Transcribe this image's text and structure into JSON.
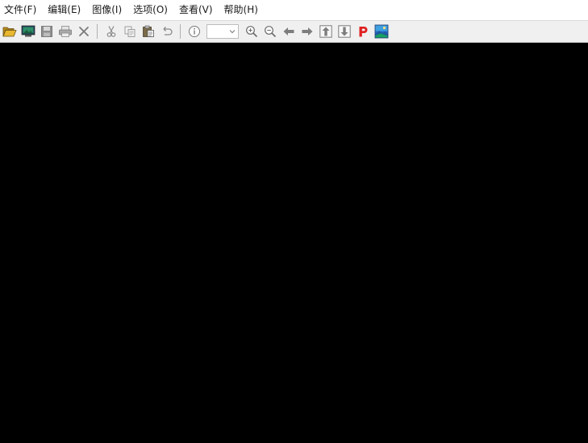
{
  "menu": {
    "items": [
      {
        "id": "file",
        "label": "文件(F)"
      },
      {
        "id": "edit",
        "label": "编辑(E)"
      },
      {
        "id": "image",
        "label": "图像(I)"
      },
      {
        "id": "options",
        "label": "选项(O)"
      },
      {
        "id": "view",
        "label": "查看(V)"
      },
      {
        "id": "help",
        "label": "帮助(H)"
      }
    ]
  },
  "toolbar": {
    "buttons": [
      "open-folder-icon",
      "screen-capture-icon",
      "save-icon",
      "print-icon",
      "delete-icon",
      "cut-icon",
      "copy-icon",
      "paste-icon",
      "undo-icon",
      "info-icon",
      "zoom-in-icon",
      "zoom-out-icon",
      "arrow-left-icon",
      "arrow-right-icon",
      "arrow-up-icon",
      "arrow-down-icon",
      "p-icon",
      "image-icon"
    ],
    "zoom_value": ""
  },
  "colors": {
    "canvas_background": "#000000",
    "toolbar_background": "#f0f0f0",
    "p_icon_red": "#e02020",
    "folder_yellow": "#e8b830",
    "image_icon_blue": "#2a6cc8"
  }
}
